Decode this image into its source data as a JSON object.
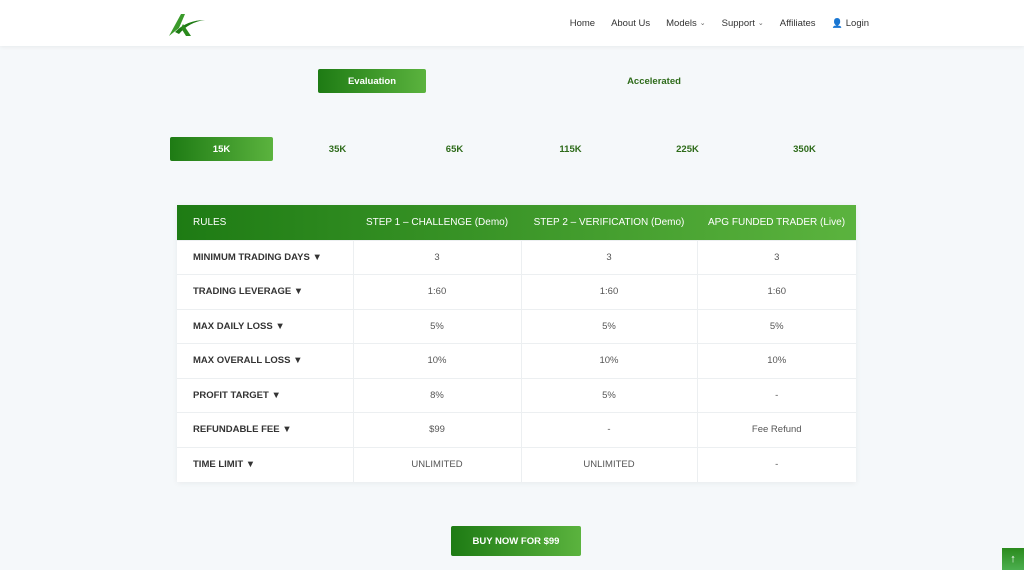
{
  "nav": {
    "items": [
      {
        "label": "Home",
        "has_dropdown": false
      },
      {
        "label": "About Us",
        "has_dropdown": false
      },
      {
        "label": "Models",
        "has_dropdown": true
      },
      {
        "label": "Support",
        "has_dropdown": true
      },
      {
        "label": "Affiliates",
        "has_dropdown": false
      }
    ],
    "login_label": "Login",
    "chevron_glyph": "⌄",
    "login_icon_glyph": "👤"
  },
  "model_tabs": [
    {
      "label": "Evaluation",
      "active": true
    },
    {
      "label": "Accelerated",
      "active": false
    }
  ],
  "size_tabs": [
    {
      "label": "15K",
      "active": true
    },
    {
      "label": "35K",
      "active": false
    },
    {
      "label": "65K",
      "active": false
    },
    {
      "label": "115K",
      "active": false
    },
    {
      "label": "225K",
      "active": false
    },
    {
      "label": "350K",
      "active": false
    }
  ],
  "table": {
    "headers": [
      "RULES",
      "STEP 1 – CHALLENGE (Demo)",
      "STEP 2 – VERIFICATION (Demo)",
      "APG FUNDED TRADER (Live)"
    ],
    "rows": [
      {
        "rule": "MINIMUM TRADING DAYS ▼",
        "values": [
          "3",
          "3",
          "3"
        ]
      },
      {
        "rule": "TRADING LEVERAGE ▼",
        "values": [
          "1:60",
          "1:60",
          "1:60"
        ]
      },
      {
        "rule": "MAX DAILY LOSS ▼",
        "values": [
          "5%",
          "5%",
          "5%"
        ]
      },
      {
        "rule": "MAX OVERALL LOSS ▼",
        "values": [
          "10%",
          "10%",
          "10%"
        ]
      },
      {
        "rule": "PROFIT TARGET ▼",
        "values": [
          "8%",
          "5%",
          "-"
        ]
      },
      {
        "rule": "REFUNDABLE FEE ▼",
        "values": [
          "$99",
          "-",
          "Fee Refund"
        ]
      },
      {
        "rule": "TIME LIMIT ▼",
        "values": [
          "UNLIMITED",
          "UNLIMITED",
          "-"
        ]
      }
    ]
  },
  "buy_button_label": "BUY NOW FOR $99",
  "scroll_top_glyph": "↑",
  "colors": {
    "accent_dark": "#1e7b14",
    "accent_light": "#5bb33e",
    "tab_text": "#2e6b1a"
  }
}
